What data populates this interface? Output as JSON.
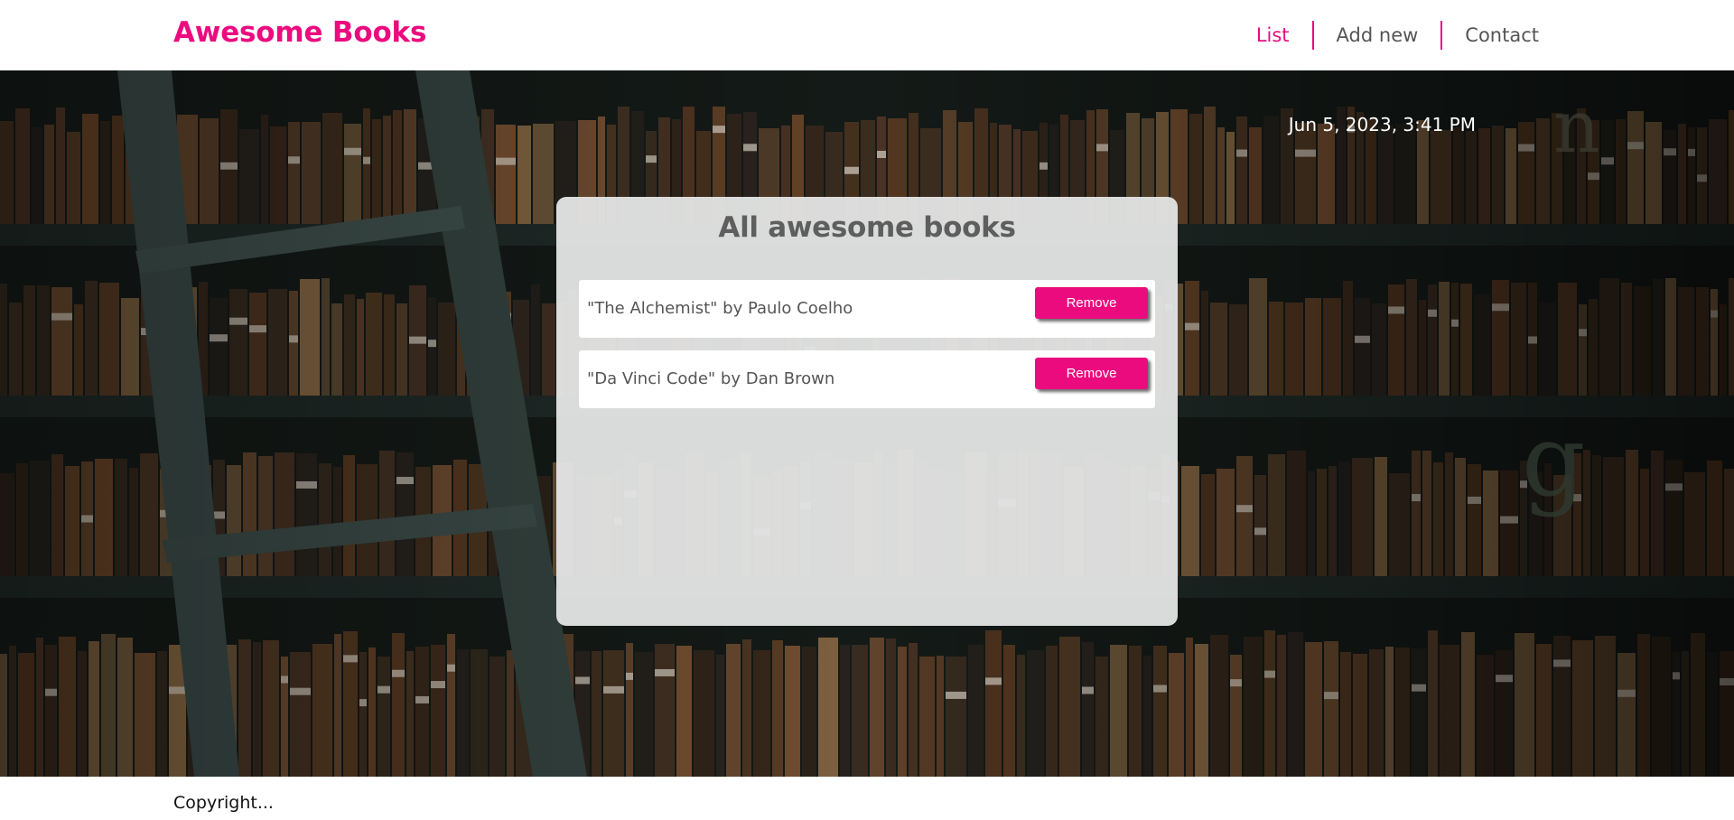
{
  "header": {
    "logo": "Awesome Books",
    "nav": [
      {
        "label": "List",
        "active": true
      },
      {
        "label": "Add new",
        "active": false
      },
      {
        "label": "Contact",
        "active": false
      }
    ]
  },
  "main": {
    "datetime": "Jun 5, 2023, 3:41 PM",
    "card_title": "All awesome books",
    "books": [
      {
        "text": "\"The Alchemist\" by Paulo Coelho",
        "button_label": "Remove"
      },
      {
        "text": "\"Da Vinci Code\" by Dan Brown",
        "button_label": "Remove"
      }
    ]
  },
  "footer": {
    "copyright": "Copyright..."
  },
  "colors": {
    "accent": "#ec0b7f",
    "card_bg": "#e2e3e3",
    "text_gray": "#555555"
  }
}
